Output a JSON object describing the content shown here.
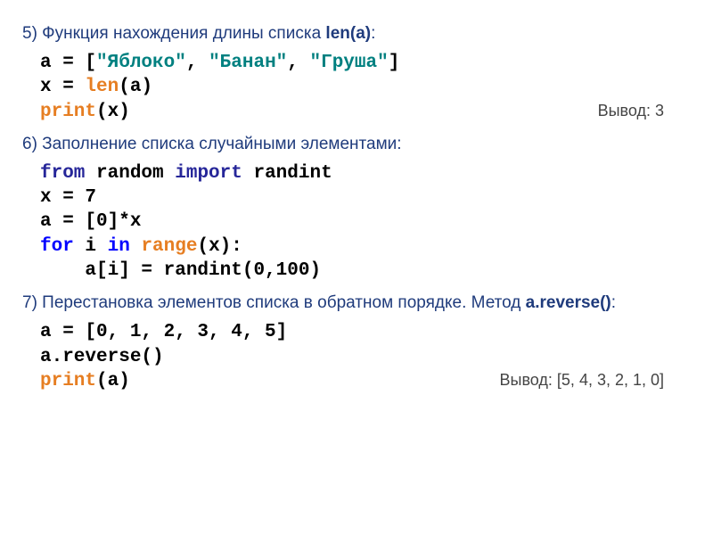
{
  "section5": {
    "heading_prefix": "5) Функция нахождения длины списка ",
    "heading_func": "len(a)",
    "heading_suffix": ":",
    "code_line1_pre": "a = [",
    "code_line1_s1": "\"Яблоко\"",
    "code_line1_c1": ", ",
    "code_line1_s2": "\"Банан\"",
    "code_line1_c2": ", ",
    "code_line1_s3": "\"Груша\"",
    "code_line1_post": "]",
    "code_line2_pre": "x = ",
    "code_line2_fn": "len",
    "code_line2_post": "(a)",
    "code_line3_fn": "print",
    "code_line3_post": "(x)",
    "output": "Вывод: 3"
  },
  "section6": {
    "heading": "6) Заполнение списка случайными элементами:",
    "line1_kw1": "from",
    "line1_mid": " random ",
    "line1_kw2": "import",
    "line1_post": " randint",
    "line2": "x = 7",
    "line3": "a = [0]*x",
    "line4_kw1": "for",
    "line4_mid1": " i ",
    "line4_kw2": "in",
    "line4_mid2": " ",
    "line4_fn": "range",
    "line4_post": "(x):",
    "line5": "    a[i] = randint(0,100)"
  },
  "section7": {
    "heading_prefix": "7) Перестановка элементов списка в обратном порядке. Метод ",
    "heading_func": "a.reverse()",
    "heading_suffix": ":",
    "line1": "a = [0, 1, 2, 3, 4, 5]",
    "line2": "a.reverse()",
    "line3_fn": "print",
    "line3_post": "(a)",
    "output": "Вывод: [5, 4, 3, 2, 1, 0]"
  }
}
